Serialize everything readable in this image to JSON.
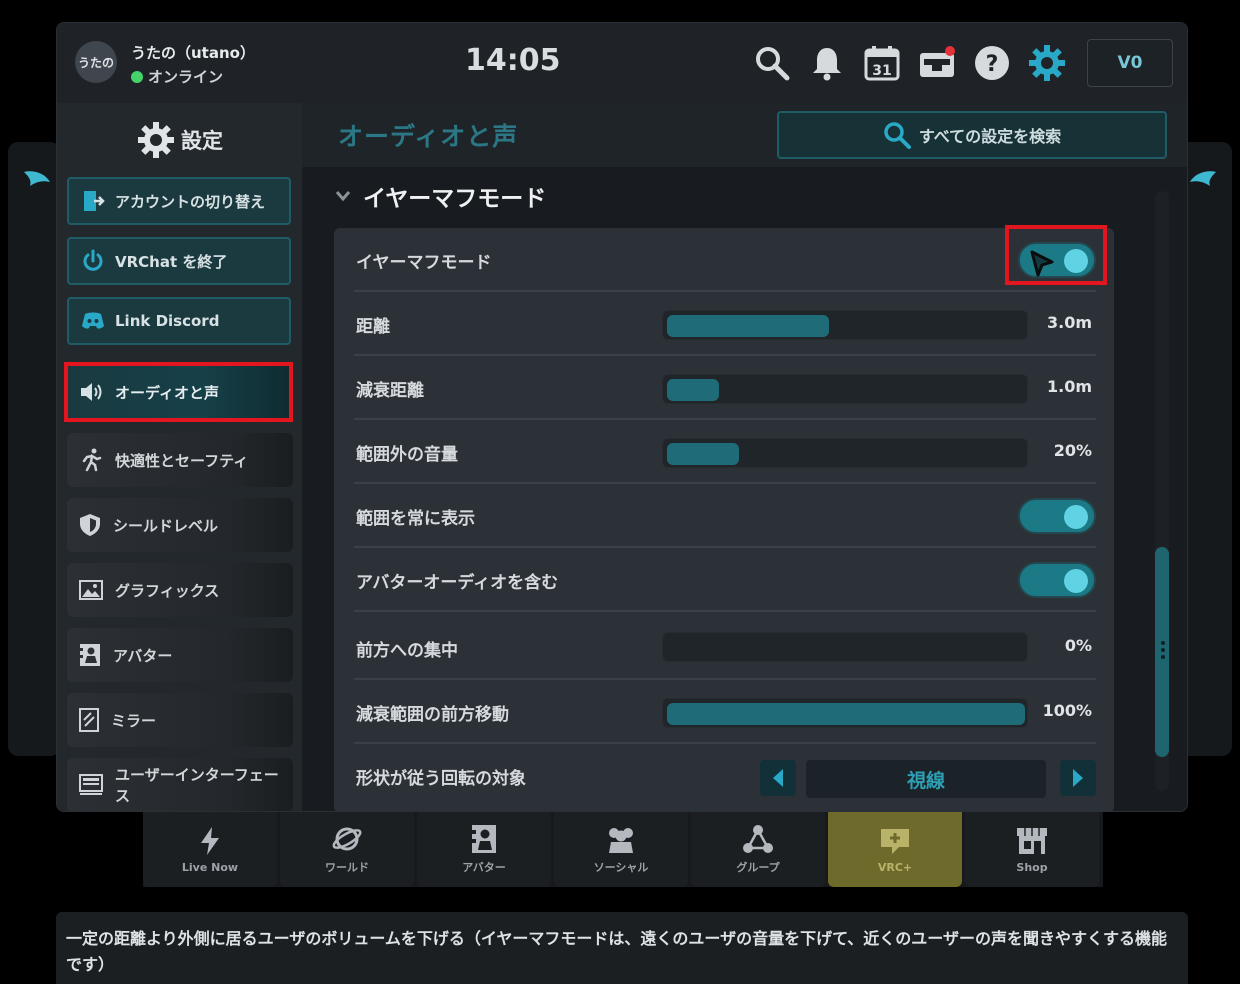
{
  "user": {
    "avatar_text": "うたの",
    "name": "うたの（utano）",
    "status": "オンライン"
  },
  "clock": "14:05",
  "calendar_day": "31",
  "balance": "V0",
  "sidebar": {
    "title": "設定",
    "buttons": [
      {
        "label": "アカウントの切り替え"
      },
      {
        "label": "VRChat を終了"
      },
      {
        "label": "Link Discord"
      }
    ],
    "items": [
      {
        "label": "オーディオと声"
      },
      {
        "label": "快適性とセーフティ"
      },
      {
        "label": "シールドレベル"
      },
      {
        "label": "グラフィックス"
      },
      {
        "label": "アバター"
      },
      {
        "label": "ミラー"
      },
      {
        "label": "ユーザーインターフェース"
      }
    ]
  },
  "content": {
    "title": "オーディオと声",
    "search_label": "すべての設定を検索",
    "section_title": "イヤーマフモード",
    "rows": [
      {
        "label": "イヤーマフモード",
        "type": "toggle",
        "on": true
      },
      {
        "label": "距離",
        "type": "slider",
        "value": "3.0m",
        "fraction": 0.44
      },
      {
        "label": "減衰距離",
        "type": "slider",
        "value": "1.0m",
        "fraction": 0.14
      },
      {
        "label": "範囲外の音量",
        "type": "slider",
        "value": "20%",
        "fraction": 0.2
      },
      {
        "label": "範囲を常に表示",
        "type": "toggle",
        "on": true
      },
      {
        "label": "アバターオーディオを含む",
        "type": "toggle",
        "on": true
      },
      {
        "label": "前方への集中",
        "type": "slider",
        "value": "0%",
        "fraction": 0
      },
      {
        "label": "減衰範囲の前方移動",
        "type": "slider",
        "value": "100%",
        "fraction": 1
      },
      {
        "label": "形状が従う回転の対象",
        "type": "select",
        "value": "視線"
      }
    ]
  },
  "dock": [
    {
      "label": "Live Now",
      "icon": "lightning-icon"
    },
    {
      "label": "ワールド",
      "icon": "planet-icon"
    },
    {
      "label": "アバター",
      "icon": "avatar-icon"
    },
    {
      "label": "ソーシャル",
      "icon": "people-icon"
    },
    {
      "label": "グループ",
      "icon": "group-icon"
    },
    {
      "label": "VRC+",
      "icon": "vrcplus-icon"
    },
    {
      "label": "Shop",
      "icon": "shop-icon"
    }
  ],
  "hint_text": "一定の距離より外側に居るユーザのボリュームを下げる（イヤーマフモードは、遠くのユーザの音量を下げて、近くのユーザーの声を聞きやすくする機能です）",
  "colors": {
    "accent": "#1c7a87",
    "highlight": "#e3161f",
    "vrc_plus": "#6e6a2c"
  }
}
